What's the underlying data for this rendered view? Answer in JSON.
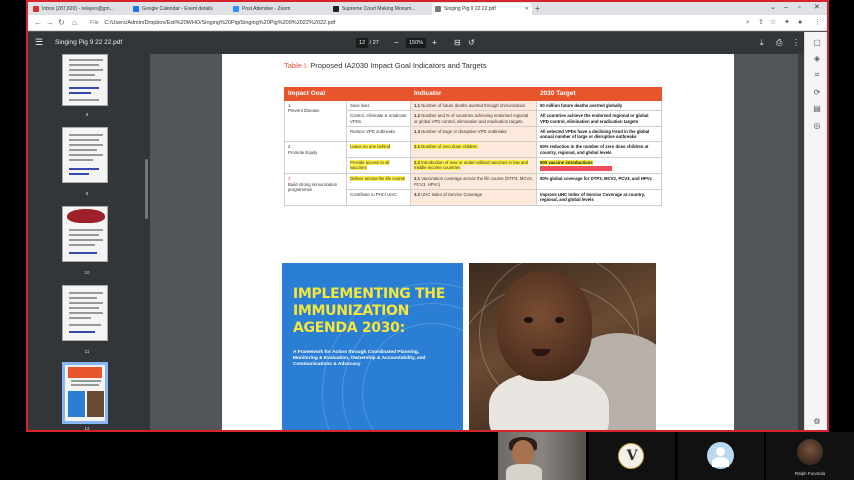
{
  "browser": {
    "tabs": [
      {
        "label": "Inbox (287,820) - relayes@gm...",
        "color": "#d93025",
        "active": false
      },
      {
        "label": "Google Calendar - Event details",
        "color": "#1a73e8",
        "active": false
      },
      {
        "label": "Post Attendee - Zoom",
        "color": "#2d8cff",
        "active": false
      },
      {
        "label": "Supreme Court Making Monum...",
        "color": "#202124",
        "active": false
      },
      {
        "label": "Singing Pig 9 22 22.pdf",
        "color": "#555",
        "active": true
      }
    ],
    "new_tab": "+",
    "address_prefix": "File",
    "address": "C:/Users/Admin/Dropbox/Exil%20WHO/Singing%20Pig/Singing%20Pig%209%2022%2022.pdf"
  },
  "pdf": {
    "title": "Singing Pig 9 22 22.pdf",
    "page_current": "12",
    "page_total": "/ 27",
    "zoom": "150%",
    "thumbnails": [
      {
        "num": "8"
      },
      {
        "num": "9"
      },
      {
        "num": "10"
      },
      {
        "num": "11"
      },
      {
        "num": "12"
      }
    ]
  },
  "document": {
    "table_label": "Table I.",
    "table_title": "Proposed IA2030 Impact Goal Indicators and Targets",
    "headers": {
      "goal": "Impact Goal",
      "indicator": "Indicator",
      "target": "2030 Target"
    },
    "goals": [
      {
        "num": "1",
        "name": "Prevent Disease"
      },
      {
        "num": "2",
        "name": "Promote Equity"
      },
      {
        "num": "3",
        "name": "Build strong immunization programmes"
      }
    ],
    "rows": [
      {
        "sub": "Save lives",
        "ind_num": "1.1",
        "ind": "Number of future deaths averted through immunization",
        "tgt": "50 million future deaths averted globally"
      },
      {
        "sub": "Control, eliminate & eradicate VPDs",
        "ind_num": "1.2",
        "ind": "Number and % of countries achieving endorsed regional or global VPD control, elimination and eradication targets",
        "tgt": "All countries achieve the endorsed regional or global VPD control, elimination and eradication targets"
      },
      {
        "sub": "Reduce VPD outbreaks",
        "ind_num": "1.3",
        "ind": "Number of large or disruptive VPD outbreaks",
        "tgt": "All selected VPDs have a declining trend in the global annual number of large or disruptive outbreaks"
      },
      {
        "sub": "Leave no one behind",
        "ind_num": "2.1",
        "ind": "Number of zero dose children",
        "tgt": "50% reduction in the number of zero dose children at country, regional, and global levels"
      },
      {
        "sub": "Provide access to all vaccines",
        "ind_num": "2.2",
        "ind": "Introduction of new or under-utilized vaccines in low and middle income countries",
        "tgt": "500 vaccine introductions"
      },
      {
        "sub": "Deliver across the life course",
        "ind_num": "3.1",
        "ind": "Vaccination coverage across the life course (DTP3, MCV2, PCV3, HPVc)",
        "tgt": "90% global coverage for DTP3, MCV2, PCV3, and HPVc"
      },
      {
        "sub": "Contribute to PHC/ UHC",
        "ind_num": "3.2",
        "ind": "UHC index of Service Coverage",
        "tgt": "Improve UHC Index of Service Coverage at country, regional, and global levels"
      }
    ],
    "cover_title": "IMPLEMENTING THE IMMUNIZATION AGENDA 2030:",
    "cover_subtitle": "A Framework for Action through Coordinated Planning, Monitoring & Evaluation, Ownership & Accountability, and Communications & Advocacy"
  },
  "participants": {
    "logo_letter": "V",
    "ralph_name": "Ralph Fucetola"
  },
  "colors": {
    "accent": "#e8552d",
    "share_border": "#d6232c",
    "cover_blue": "#2a7fd4",
    "cover_yellow": "#f7e63a"
  },
  "icons": [
    "menu-icon",
    "zoom-out-icon",
    "zoom-in-icon",
    "fit-page-icon",
    "rotate-icon",
    "download-icon",
    "print-icon",
    "more-icon"
  ]
}
